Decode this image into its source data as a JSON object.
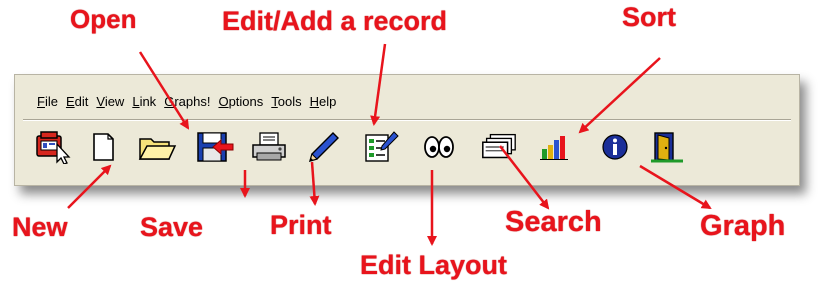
{
  "menubar": {
    "items": [
      {
        "first": "F",
        "rest": "ile"
      },
      {
        "first": "E",
        "rest": "dit"
      },
      {
        "first": "V",
        "rest": "iew"
      },
      {
        "first": "L",
        "rest": "ink"
      },
      {
        "first": "G",
        "rest": "raphs!"
      },
      {
        "first": "O",
        "rest": "ptions"
      },
      {
        "first": "T",
        "rest": "ools"
      },
      {
        "first": "H",
        "rest": "elp"
      }
    ]
  },
  "toolbar": {
    "buttons": [
      {
        "name": "new-button",
        "icon": "database-cursor-icon"
      },
      {
        "name": "new-page-button",
        "icon": "blank-page-icon"
      },
      {
        "name": "open-button",
        "icon": "folder-open-icon"
      },
      {
        "name": "save-button",
        "icon": "floppy-save-icon"
      },
      {
        "name": "print-button",
        "icon": "printer-icon"
      },
      {
        "name": "edit-record-button",
        "icon": "pencil-icon"
      },
      {
        "name": "edit-layout-button",
        "icon": "form-layout-icon"
      },
      {
        "name": "search-button",
        "icon": "eyes-icon"
      },
      {
        "name": "sort-button",
        "icon": "card-stack-icon"
      },
      {
        "name": "graph-button",
        "icon": "bar-chart-icon"
      },
      {
        "name": "info-button",
        "icon": "info-icon"
      },
      {
        "name": "exit-button",
        "icon": "exit-door-icon"
      }
    ]
  },
  "callouts": {
    "open": "Open",
    "edit_add": "Edit/Add a record",
    "sort": "Sort",
    "new": "New",
    "save": "Save",
    "print": "Print",
    "search": "Search",
    "graph": "Graph",
    "edit_layout": "Edit Layout"
  },
  "colors": {
    "callout": "#e8141c",
    "window_bg": "#ece9d8"
  }
}
